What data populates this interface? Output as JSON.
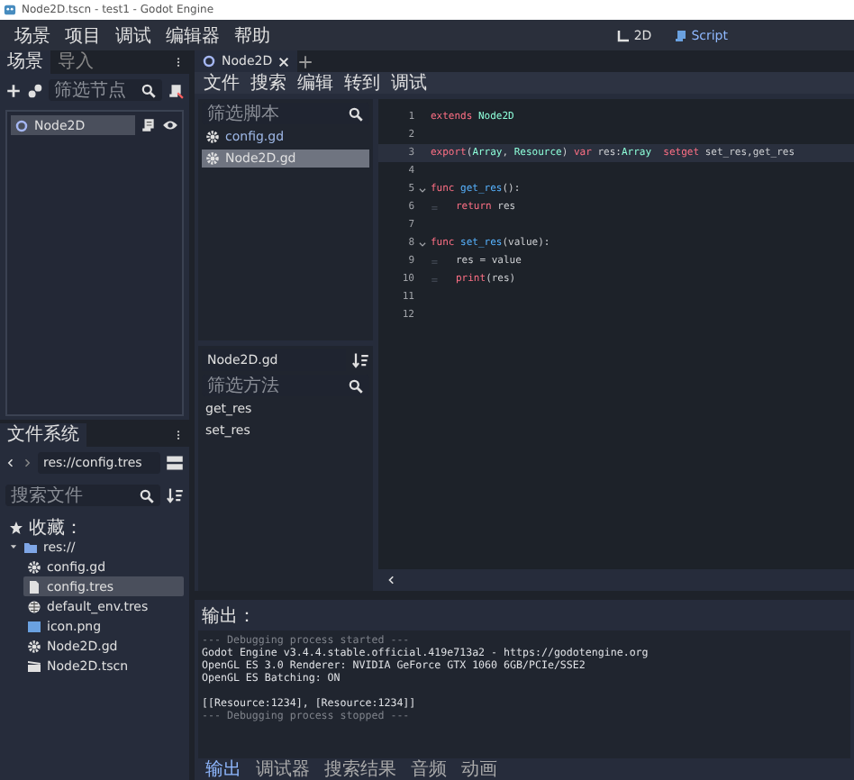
{
  "window": {
    "title": "Node2D.tscn - test1 - Godot Engine"
  },
  "menu": [
    "场景",
    "项目",
    "调试",
    "编辑器",
    "帮助"
  ],
  "workspaces": [
    {
      "label": "2D",
      "kind": "axes",
      "selected": false
    },
    {
      "label": "Script",
      "kind": "script",
      "selected": true
    }
  ],
  "scene_dock": {
    "tabs": [
      {
        "label": "场景",
        "selected": true
      },
      {
        "label": "导入",
        "selected": false
      }
    ],
    "filter": {
      "placeholder": "筛选节点"
    },
    "tree": [
      {
        "label": "Node2D",
        "selected": true
      }
    ]
  },
  "filesystem_dock": {
    "tabs": [
      {
        "label": "文件系统",
        "selected": true
      }
    ],
    "path": "res://config.tres",
    "search": {
      "placeholder": "搜索文件"
    },
    "tree": [
      {
        "label": "收藏：",
        "kind": "favorites",
        "selected": false
      },
      {
        "label": "res://",
        "kind": "folder",
        "expanded": true,
        "selected": false,
        "children": [
          {
            "label": "config.gd",
            "kind": "script",
            "selected": false
          },
          {
            "label": "config.tres",
            "kind": "resource",
            "selected": true
          },
          {
            "label": "default_env.tres",
            "kind": "environment",
            "selected": false
          },
          {
            "label": "icon.png",
            "kind": "image",
            "selected": false
          },
          {
            "label": "Node2D.gd",
            "kind": "script",
            "selected": false
          },
          {
            "label": "Node2D.tscn",
            "kind": "scene",
            "selected": false
          }
        ]
      }
    ]
  },
  "script_editor": {
    "tabs": [
      {
        "label": "Node2D",
        "selected": true
      }
    ],
    "menu": [
      "文件",
      "搜索",
      "编辑",
      "转到",
      "调试"
    ],
    "script_filter": {
      "placeholder": "筛选脚本"
    },
    "scripts": [
      {
        "label": "config.gd",
        "selected": false
      },
      {
        "label": "Node2D.gd",
        "selected": true
      }
    ],
    "current_script": "Node2D.gd",
    "method_filter": {
      "placeholder": "筛选方法"
    },
    "methods": [
      "get_res",
      "set_res"
    ],
    "code": [
      {
        "number": "1",
        "highlighted": false,
        "foldable": false,
        "indented": false,
        "tokens": [
          {
            "text": "extends",
            "kind": "keyword"
          },
          {
            "text": " Node2D",
            "kind": "type"
          }
        ]
      },
      {
        "number": "2",
        "highlighted": false,
        "foldable": false,
        "indented": false
      },
      {
        "number": "3",
        "highlighted": true,
        "foldable": false,
        "indented": false,
        "tokens": [
          {
            "text": "export",
            "kind": "keyword"
          },
          {
            "text": "(",
            "kind": "plain"
          },
          {
            "text": "Array",
            "kind": "type"
          },
          {
            "text": ", ",
            "kind": "plain"
          },
          {
            "text": "Resource",
            "kind": "type"
          },
          {
            "text": ") ",
            "kind": "plain"
          },
          {
            "text": "var",
            "kind": "keyword"
          },
          {
            "text": " res:",
            "kind": "plain"
          },
          {
            "text": "Array",
            "kind": "type"
          },
          {
            "text": "  setget",
            "kind": "keyword"
          },
          {
            "text": " set_res,get_res",
            "kind": "plain"
          }
        ]
      },
      {
        "number": "4",
        "highlighted": false,
        "foldable": false,
        "indented": false
      },
      {
        "number": "5",
        "highlighted": false,
        "foldable": true,
        "indented": false,
        "tokens": [
          {
            "text": "func",
            "kind": "keyword"
          },
          {
            "text": " get_res",
            "kind": "function"
          },
          {
            "text": "():",
            "kind": "plain"
          }
        ]
      },
      {
        "number": "6",
        "highlighted": false,
        "foldable": false,
        "indented": true,
        "tokens": [
          {
            "text": "return",
            "kind": "keyword"
          },
          {
            "text": " res",
            "kind": "plain"
          }
        ]
      },
      {
        "number": "7",
        "highlighted": false,
        "foldable": false,
        "indented": false
      },
      {
        "number": "8",
        "highlighted": false,
        "foldable": true,
        "indented": false,
        "tokens": [
          {
            "text": "func",
            "kind": "keyword"
          },
          {
            "text": " set_res",
            "kind": "function"
          },
          {
            "text": "(value):",
            "kind": "plain"
          }
        ]
      },
      {
        "number": "9",
        "highlighted": false,
        "foldable": false,
        "indented": true,
        "tokens": [
          {
            "text": "res = value",
            "kind": "plain"
          }
        ]
      },
      {
        "number": "10",
        "highlighted": false,
        "foldable": false,
        "indented": true,
        "tokens": [
          {
            "text": "print",
            "kind": "builtin"
          },
          {
            "text": "(res)",
            "kind": "plain"
          }
        ]
      },
      {
        "number": "11",
        "highlighted": false,
        "foldable": false,
        "indented": false
      },
      {
        "number": "12",
        "highlighted": false,
        "foldable": false,
        "indented": false
      }
    ]
  },
  "output": {
    "title": "输出：",
    "lines": [
      {
        "text": "--- Debugging process started ---",
        "kind": "dim",
        "gap_before": false
      },
      {
        "text": "Godot Engine v3.4.4.stable.official.419e713a2 - https://godotengine.org",
        "kind": "plain",
        "gap_before": false
      },
      {
        "text": "OpenGL ES 3.0 Renderer: NVIDIA GeForce GTX 1060 6GB/PCIe/SSE2",
        "kind": "plain",
        "gap_before": false
      },
      {
        "text": "OpenGL ES Batching: ON",
        "kind": "plain",
        "gap_before": false
      },
      {
        "text": "[[Resource:1234], [Resource:1234]]",
        "kind": "plain",
        "gap_before": true
      },
      {
        "text": "--- Debugging process stopped ---",
        "kind": "dim",
        "gap_before": false
      }
    ],
    "tabs": [
      {
        "label": "输出",
        "selected": true
      },
      {
        "label": "调试器",
        "selected": false
      },
      {
        "label": "搜索结果",
        "selected": false
      },
      {
        "label": "音频",
        "selected": false
      },
      {
        "label": "动画",
        "selected": false
      }
    ]
  }
}
